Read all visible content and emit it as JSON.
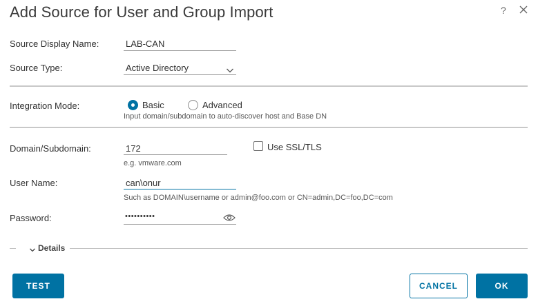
{
  "dialog": {
    "title": "Add Source for User and Group Import",
    "help_label": "?"
  },
  "form": {
    "source_display_name": {
      "label": "Source Display Name:",
      "value": "LAB-CAN"
    },
    "source_type": {
      "label": "Source Type:",
      "value": "Active Directory"
    },
    "integration_mode": {
      "label": "Integration Mode:",
      "options": [
        {
          "label": "Basic",
          "selected": true
        },
        {
          "label": "Advanced",
          "selected": false
        }
      ],
      "hint": "Input domain/subdomain to auto-discover host and Base DN"
    },
    "domain": {
      "label": "Domain/Subdomain:",
      "value": "172",
      "hint": "e.g. vmware.com"
    },
    "use_ssl": {
      "label": "Use SSL/TLS",
      "checked": false
    },
    "user_name": {
      "label": "User Name:",
      "value": "can\\onur",
      "hint": "Such as DOMAIN\\username or admin@foo.com or CN=admin,DC=foo,DC=com"
    },
    "password": {
      "label": "Password:",
      "value": "••••••••••"
    }
  },
  "details": {
    "label": "Details"
  },
  "buttons": {
    "test": "TEST",
    "cancel": "CANCEL",
    "ok": "OK"
  }
}
